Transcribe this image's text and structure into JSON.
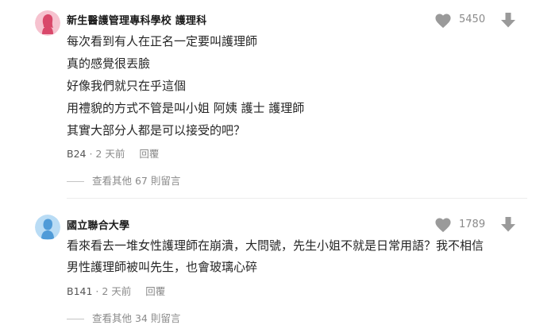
{
  "comments": [
    {
      "author": "新生醫護管理專科學校 護理科",
      "likes": "5450",
      "lines": [
        "每次看到有人在正名一定要叫護理師",
        "真的感覺很丟臉",
        "好像我們就只在乎這個",
        "用禮貌的方式不管是叫小姐 阿姨 護士 護理師",
        "其實大部分人都是可以接受的吧？"
      ],
      "floor": "B24",
      "time": "2 天前",
      "reply_label": "回覆",
      "more_replies": "查看其他 67 則留言",
      "avatar_color": "#f0a7b8"
    },
    {
      "author": "國立聯合大學",
      "likes": "1789",
      "lines": [
        "看來看去一堆女性護理師在崩潰，大問號，先生小姐不就是日常用語？我不相信",
        "男性護理師被叫先生，也會玻璃心碎"
      ],
      "floor": "B141",
      "time": "2 天前",
      "reply_label": "回覆",
      "more_replies": "查看其他 34 則留言",
      "avatar_color": "#7fb8e6"
    }
  ],
  "colors": {
    "muted": "#8a8a8a",
    "icon": "#9a9a9a",
    "text": "#262626"
  },
  "icons": [
    "heart-icon",
    "arrow-down-icon",
    "avatar-female-icon",
    "avatar-male-icon"
  ]
}
